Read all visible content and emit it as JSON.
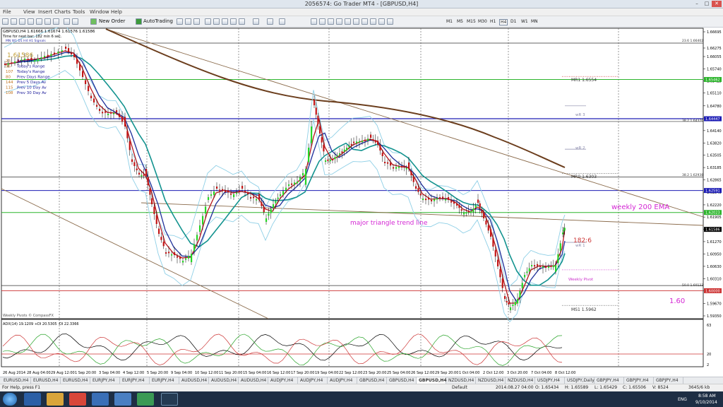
{
  "window": {
    "title": "2056574: Go Trader MT4 - [GBPUSD,H4]"
  },
  "menu": [
    "File",
    "View",
    "Insert",
    "Charts",
    "Tools",
    "Window",
    "Help"
  ],
  "toolbar": {
    "new_order": "New Order",
    "autotrading": "AutoTrading",
    "timeframes": [
      "M1",
      "M5",
      "M15",
      "M30",
      "H1",
      "H4",
      "D1",
      "W1",
      "MN"
    ],
    "active_timeframe": "H4"
  },
  "chart": {
    "header": "GBPUSD,H4  1.61666 1.61674 1.61576 1.61586",
    "next_bar": "Time for next bar: 182 min 6 sec.",
    "mtf_labels": "MN  W1  D1  H4  H1  Signals",
    "price_big": "1.61586",
    "pips_stats": [
      {
        "value": "23",
        "label": "Spread"
      },
      {
        "value": "96",
        "label": "Today's Range"
      },
      {
        "value": "107",
        "label": "Today's Range"
      },
      {
        "value": "80",
        "label": "Prev Days Range"
      },
      {
        "value": "144",
        "label": "Prev 5 Days Av"
      },
      {
        "value": "115",
        "label": "Prev 10 Day Av"
      },
      {
        "value": "108",
        "label": "Prev 30 Day Av"
      }
    ],
    "annotations": {
      "trend_line": "major triangle trend line",
      "weekly_ema": "weekly 200 EMA",
      "level_160": "1.60",
      "countdown": "182:6"
    },
    "pivots": {
      "mr1": "MR1  1.6554",
      "wr3": "wR 3",
      "wr2": "wR 2",
      "mr0": "MR0  1.6303",
      "wr1": "wR 1",
      "weekly_pivot": "Weekly Pivot",
      "ms1": "MS1  1.5962",
      "fib_236": "23.6  1.66402",
      "fib_382a": "38.2  1.64376",
      "fib_382b": "38.2  1.62938",
      "fib_50": "50.0  1.60133"
    },
    "footer_credit": "Weekly Pivots  © CompassFX",
    "price_axis": [
      "1.66695",
      "1.66275",
      "1.66055",
      "1.65740",
      "1.65425",
      "1.65110",
      "1.64780",
      "1.64465",
      "1.64140",
      "1.63820",
      "1.63505",
      "1.63185",
      "1.62865",
      "1.62545",
      "1.62220",
      "1.61905",
      "1.61586",
      "1.61270",
      "1.60950",
      "1.60630",
      "1.60310",
      "1.60000",
      "1.59670",
      "1.59350"
    ],
    "price_tags": {
      "current": "1.61586",
      "green_upper": "1.65462",
      "blue_upper": "1.64447",
      "blue_lower": "1.62591",
      "green_lower": "1.62023",
      "red": "1.60000"
    },
    "time_axis": [
      "26 Aug 2014",
      "28 Aug 04:00",
      "29 Aug 12:00",
      "1 Sep 20:00",
      "3 Sep 04:00",
      "4 Sep 12:00",
      "5 Sep 20:00",
      "9 Sep 04:00",
      "10 Sep 12:00",
      "11 Sep 20:00",
      "15 Sep 04:00",
      "16 Sep 12:00",
      "17 Sep 20:00",
      "19 Sep 04:00",
      "22 Sep 12:00",
      "23 Sep 20:00",
      "25 Sep 04:00",
      "26 Sep 12:00",
      "29 Sep 20:00",
      "1 Oct 04:00",
      "2 Oct 12:00",
      "3 Oct 20:00",
      "7 Oct 04:00",
      "8 Oct 12:00"
    ],
    "adx_header": "ADX(14) 19.1209 +DI 20.5305 -DI 22.3366",
    "adx_axis": [
      "63",
      "20",
      "2"
    ]
  },
  "tabs": [
    "EURUSD,H4",
    "EURUSD,H4",
    "EURUSD,H4",
    "EURJPY,H4",
    "EURJPY,H4",
    "EURJPY,H4",
    "AUDUSD,H4",
    "AUDUSD,H4",
    "AUDUSD,H4",
    "AUDJPY,H4",
    "AUDJPY,H4",
    "AUDJPY,H4",
    "GBPUSD,H4",
    "GBPUSD,H4",
    "GBPUSD,H4",
    "NZDUSD,H4",
    "NZDUSD,H4",
    "NZDUSD,H4",
    "USDJPY,H4",
    "USDJPY,Daily",
    "GBPJPY,H4",
    "GBPJPY,H4",
    "GBPJPY,H4"
  ],
  "active_tab_index": 14,
  "status": {
    "help": "For Help, press F1",
    "profile": "Default",
    "time": "2014.08.27 04:00",
    "open": "O: 1.65434",
    "high": "H: 1.65589",
    "low": "L: 1.65429",
    "close": "C: 1.65506",
    "volume": "V: 8524",
    "traffic": "3645/6 kb"
  },
  "taskbar": {
    "clock_time": "8:58 AM",
    "clock_date": "9/10/2014",
    "lang": "ENG"
  }
}
